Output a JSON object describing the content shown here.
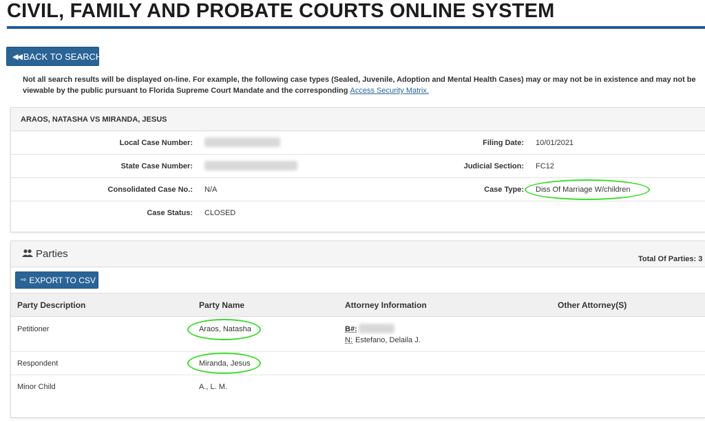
{
  "page": {
    "title": "CIVIL, FAMILY AND PROBATE COURTS ONLINE SYSTEM"
  },
  "back_button": {
    "label": "BACK TO SEARCH",
    "icon": "double-left-arrow-icon"
  },
  "notice": {
    "text": "Not all search results will be displayed on-line. For example, the following case types (Sealed, Juvenile, Adoption and Mental Health Cases) may or may not be in existence and may not be viewable by the public pursuant to Florida Supreme Court Mandate and the corresponding",
    "link": "Access Security Matrix."
  },
  "case": {
    "title": "ARAOS, NATASHA VS MIRANDA, JESUS",
    "local_case_number_label": "Local Case Number:",
    "filing_date_label": "Filing Date:",
    "filing_date": "10/01/2021",
    "state_case_number_label": "State Case Number:",
    "judicial_section_label": "Judicial Section:",
    "judicial_section": "FC12",
    "consolidated_label": "Consolidated Case No.:",
    "consolidated": "N/A",
    "case_type_label": "Case Type:",
    "case_type": "Diss Of Marriage W/children",
    "case_status_label": "Case Status:",
    "case_status": "CLOSED"
  },
  "parties": {
    "title": "Parties",
    "icon": "users-icon",
    "total_label": "Total Of Parties: 3",
    "export_label": "EXPORT TO CSV",
    "export_icon": "export-icon",
    "columns": [
      "Party Description",
      "Party Name",
      "Attorney Information",
      "Other Attorney(S)"
    ],
    "rows": [
      {
        "description": "Petitioner",
        "name": "Araos, Natasha",
        "bar_label": "B#:",
        "attorney_label": "N:",
        "attorney_name": "Estefano, Delaila J."
      },
      {
        "description": "Respondent",
        "name": "Miranda, Jesus"
      },
      {
        "description": "Minor Child",
        "name": "A., L. M."
      }
    ]
  },
  "highlight_color": "#3cdc2a",
  "accent_color": "#2a6496"
}
